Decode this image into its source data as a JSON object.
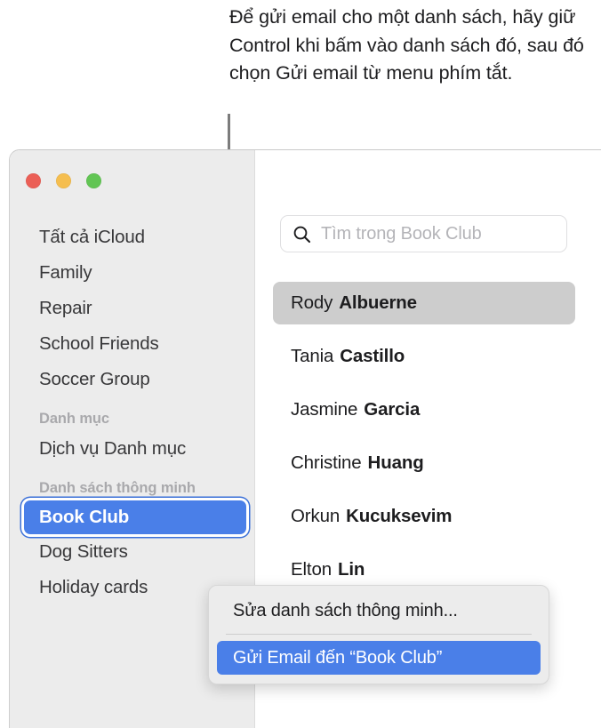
{
  "callout": {
    "text": "Để gửi email cho một danh sách, hãy giữ Control khi bấm vào danh sách đó, sau đó chọn Gửi email từ menu phím tắt."
  },
  "window": {
    "traffic_lights": [
      {
        "name": "close",
        "color": "#eb5f56"
      },
      {
        "name": "minimize",
        "color": "#f5be4f"
      },
      {
        "name": "maximize",
        "color": "#62c554"
      }
    ]
  },
  "sidebar": {
    "items": [
      {
        "type": "item",
        "label": "Tất cả iCloud",
        "selected": false
      },
      {
        "type": "item",
        "label": "Family",
        "selected": false
      },
      {
        "type": "item",
        "label": "Repair",
        "selected": false
      },
      {
        "type": "item",
        "label": "School Friends",
        "selected": false
      },
      {
        "type": "item",
        "label": "Soccer Group",
        "selected": false
      },
      {
        "type": "header",
        "label": "Danh mục"
      },
      {
        "type": "item",
        "label": "Dịch vụ Danh mục",
        "selected": false
      },
      {
        "type": "header",
        "label": "Danh sách thông minh"
      },
      {
        "type": "item",
        "label": "Book Club",
        "selected": true
      },
      {
        "type": "item",
        "label": "Dog Sitters",
        "selected": false
      },
      {
        "type": "item",
        "label": "Holiday cards",
        "selected": false
      }
    ]
  },
  "search": {
    "icon": "search-icon",
    "placeholder": "Tìm trong Book Club",
    "value": ""
  },
  "contacts": [
    {
      "first": "Rody",
      "last": "Albuerne",
      "selected": true
    },
    {
      "first": "Tania",
      "last": "Castillo",
      "selected": false
    },
    {
      "first": "Jasmine",
      "last": "Garcia",
      "selected": false
    },
    {
      "first": "Christine",
      "last": "Huang",
      "selected": false
    },
    {
      "first": "Orkun",
      "last": "Kucuksevim",
      "selected": false
    },
    {
      "first": "Elton",
      "last": "Lin",
      "selected": false
    }
  ],
  "context_menu": {
    "items": [
      {
        "label": "Sửa danh sách thông minh...",
        "highlighted": false
      },
      {
        "label": "Gửi Email đến “Book Club”",
        "highlighted": true
      }
    ]
  },
  "colors": {
    "accent_blue": "#4a7fe8",
    "sidebar_bg": "#ececec",
    "selected_row_gray": "#cdcdcd",
    "header_gray": "#a9a9ac"
  }
}
